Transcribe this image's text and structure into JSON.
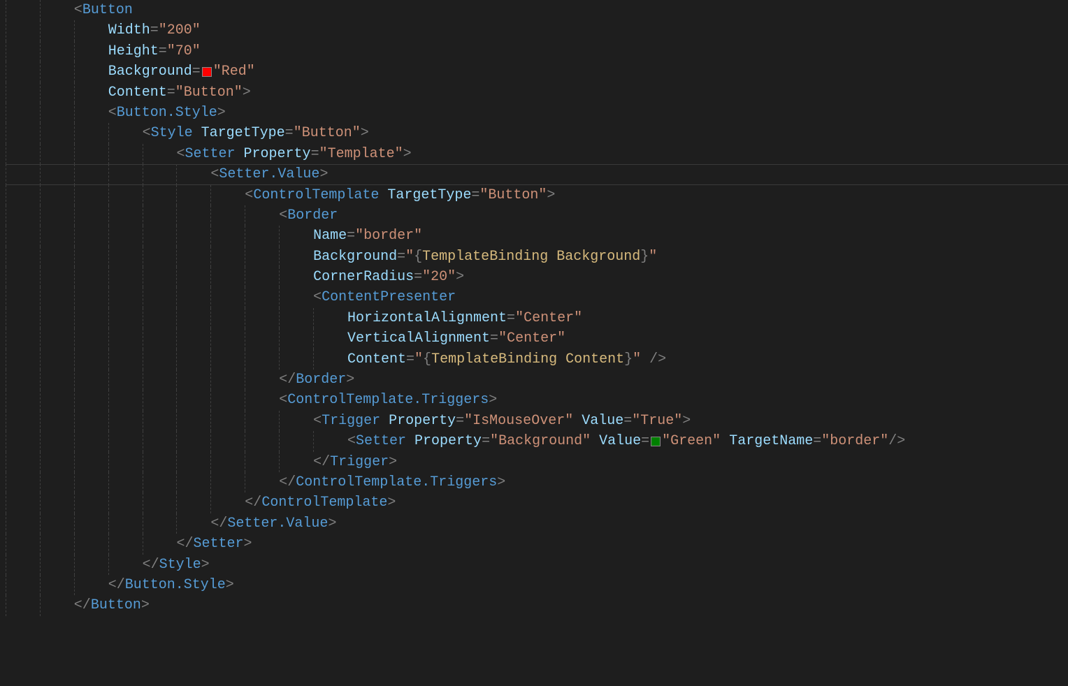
{
  "colors": {
    "red_swatch": "#ff0000",
    "green_swatch": "#008000"
  },
  "lines": [
    {
      "indent": 2,
      "tokens": [
        {
          "t": "p",
          "v": "<"
        },
        {
          "t": "tag",
          "v": "Button"
        }
      ]
    },
    {
      "indent": 3,
      "tokens": [
        {
          "t": "att",
          "v": "Width"
        },
        {
          "t": "p",
          "v": "="
        },
        {
          "t": "str",
          "v": "\"200\""
        }
      ]
    },
    {
      "indent": 3,
      "tokens": [
        {
          "t": "att",
          "v": "Height"
        },
        {
          "t": "p",
          "v": "="
        },
        {
          "t": "str",
          "v": "\"70\""
        }
      ]
    },
    {
      "indent": 3,
      "tokens": [
        {
          "t": "att",
          "v": "Background"
        },
        {
          "t": "p",
          "v": "="
        },
        {
          "t": "sw",
          "v": "red_swatch"
        },
        {
          "t": "str",
          "v": "\"Red\""
        }
      ]
    },
    {
      "indent": 3,
      "tokens": [
        {
          "t": "att",
          "v": "Content"
        },
        {
          "t": "p",
          "v": "="
        },
        {
          "t": "str",
          "v": "\"Button\""
        },
        {
          "t": "p",
          "v": ">"
        }
      ]
    },
    {
      "indent": 3,
      "tokens": [
        {
          "t": "p",
          "v": "<"
        },
        {
          "t": "tag",
          "v": "Button.Style"
        },
        {
          "t": "p",
          "v": ">"
        }
      ]
    },
    {
      "indent": 4,
      "tokens": [
        {
          "t": "p",
          "v": "<"
        },
        {
          "t": "tag",
          "v": "Style"
        },
        {
          "t": "p",
          "v": " "
        },
        {
          "t": "att",
          "v": "TargetType"
        },
        {
          "t": "p",
          "v": "="
        },
        {
          "t": "str",
          "v": "\"Button\""
        },
        {
          "t": "p",
          "v": ">"
        }
      ]
    },
    {
      "indent": 5,
      "tokens": [
        {
          "t": "p",
          "v": "<"
        },
        {
          "t": "tag",
          "v": "Setter"
        },
        {
          "t": "p",
          "v": " "
        },
        {
          "t": "att",
          "v": "Property"
        },
        {
          "t": "p",
          "v": "="
        },
        {
          "t": "str",
          "v": "\"Template\""
        },
        {
          "t": "p",
          "v": ">"
        }
      ]
    },
    {
      "indent": 6,
      "tokens": [
        {
          "t": "p",
          "v": "<"
        },
        {
          "t": "tag",
          "v": "Setter.Value"
        },
        {
          "t": "p",
          "v": ">"
        }
      ],
      "highlight": true
    },
    {
      "indent": 7,
      "tokens": [
        {
          "t": "p",
          "v": "<"
        },
        {
          "t": "tag",
          "v": "ControlTemplate"
        },
        {
          "t": "p",
          "v": " "
        },
        {
          "t": "att",
          "v": "TargetType"
        },
        {
          "t": "p",
          "v": "="
        },
        {
          "t": "str",
          "v": "\"Button\""
        },
        {
          "t": "p",
          "v": ">"
        }
      ]
    },
    {
      "indent": 8,
      "tokens": [
        {
          "t": "p",
          "v": "<"
        },
        {
          "t": "tag",
          "v": "Border"
        }
      ]
    },
    {
      "indent": 9,
      "tokens": [
        {
          "t": "att",
          "v": "Name"
        },
        {
          "t": "p",
          "v": "="
        },
        {
          "t": "str",
          "v": "\"border\""
        }
      ]
    },
    {
      "indent": 9,
      "tokens": [
        {
          "t": "att",
          "v": "Background"
        },
        {
          "t": "p",
          "v": "="
        },
        {
          "t": "str",
          "v": "\""
        },
        {
          "t": "p",
          "v": "{"
        },
        {
          "t": "bind",
          "v": "TemplateBinding"
        },
        {
          "t": "p",
          "v": " "
        },
        {
          "t": "bind",
          "v": "Background"
        },
        {
          "t": "p",
          "v": "}"
        },
        {
          "t": "str",
          "v": "\""
        }
      ]
    },
    {
      "indent": 9,
      "tokens": [
        {
          "t": "att",
          "v": "CornerRadius"
        },
        {
          "t": "p",
          "v": "="
        },
        {
          "t": "str",
          "v": "\"20\""
        },
        {
          "t": "p",
          "v": ">"
        }
      ]
    },
    {
      "indent": 9,
      "tokens": [
        {
          "t": "p",
          "v": "<"
        },
        {
          "t": "tag",
          "v": "ContentPresenter"
        }
      ]
    },
    {
      "indent": 10,
      "tokens": [
        {
          "t": "att",
          "v": "HorizontalAlignment"
        },
        {
          "t": "p",
          "v": "="
        },
        {
          "t": "str",
          "v": "\"Center\""
        }
      ]
    },
    {
      "indent": 10,
      "tokens": [
        {
          "t": "att",
          "v": "VerticalAlignment"
        },
        {
          "t": "p",
          "v": "="
        },
        {
          "t": "str",
          "v": "\"Center\""
        }
      ]
    },
    {
      "indent": 10,
      "tokens": [
        {
          "t": "att",
          "v": "Content"
        },
        {
          "t": "p",
          "v": "="
        },
        {
          "t": "str",
          "v": "\""
        },
        {
          "t": "p",
          "v": "{"
        },
        {
          "t": "bind",
          "v": "TemplateBinding"
        },
        {
          "t": "p",
          "v": " "
        },
        {
          "t": "bind",
          "v": "Content"
        },
        {
          "t": "p",
          "v": "}"
        },
        {
          "t": "str",
          "v": "\""
        },
        {
          "t": "p",
          "v": " />"
        }
      ]
    },
    {
      "indent": 8,
      "tokens": [
        {
          "t": "p",
          "v": "</"
        },
        {
          "t": "tag",
          "v": "Border"
        },
        {
          "t": "p",
          "v": ">"
        }
      ]
    },
    {
      "indent": 8,
      "tokens": [
        {
          "t": "p",
          "v": "<"
        },
        {
          "t": "tag",
          "v": "ControlTemplate.Triggers"
        },
        {
          "t": "p",
          "v": ">"
        }
      ]
    },
    {
      "indent": 9,
      "tokens": [
        {
          "t": "p",
          "v": "<"
        },
        {
          "t": "tag",
          "v": "Trigger"
        },
        {
          "t": "p",
          "v": " "
        },
        {
          "t": "att",
          "v": "Property"
        },
        {
          "t": "p",
          "v": "="
        },
        {
          "t": "str",
          "v": "\"IsMouseOver\""
        },
        {
          "t": "p",
          "v": " "
        },
        {
          "t": "att",
          "v": "Value"
        },
        {
          "t": "p",
          "v": "="
        },
        {
          "t": "str",
          "v": "\"True\""
        },
        {
          "t": "p",
          "v": ">"
        }
      ]
    },
    {
      "indent": 10,
      "tokens": [
        {
          "t": "p",
          "v": "<"
        },
        {
          "t": "tag",
          "v": "Setter"
        },
        {
          "t": "p",
          "v": " "
        },
        {
          "t": "att",
          "v": "Property"
        },
        {
          "t": "p",
          "v": "="
        },
        {
          "t": "str",
          "v": "\"Background\""
        },
        {
          "t": "p",
          "v": " "
        },
        {
          "t": "att",
          "v": "Value"
        },
        {
          "t": "p",
          "v": "="
        },
        {
          "t": "sw",
          "v": "green_swatch"
        },
        {
          "t": "str",
          "v": "\"Green\""
        },
        {
          "t": "p",
          "v": " "
        },
        {
          "t": "att",
          "v": "TargetName"
        },
        {
          "t": "p",
          "v": "="
        },
        {
          "t": "str",
          "v": "\"border\""
        },
        {
          "t": "p",
          "v": "/>"
        }
      ]
    },
    {
      "indent": 9,
      "tokens": [
        {
          "t": "p",
          "v": "</"
        },
        {
          "t": "tag",
          "v": "Trigger"
        },
        {
          "t": "p",
          "v": ">"
        }
      ]
    },
    {
      "indent": 8,
      "tokens": [
        {
          "t": "p",
          "v": "</"
        },
        {
          "t": "tag",
          "v": "ControlTemplate.Triggers"
        },
        {
          "t": "p",
          "v": ">"
        }
      ]
    },
    {
      "indent": 7,
      "tokens": [
        {
          "t": "p",
          "v": "</"
        },
        {
          "t": "tag",
          "v": "ControlTemplate"
        },
        {
          "t": "p",
          "v": ">"
        }
      ]
    },
    {
      "indent": 6,
      "tokens": [
        {
          "t": "p",
          "v": "</"
        },
        {
          "t": "tag",
          "v": "Setter.Value"
        },
        {
          "t": "p",
          "v": ">"
        }
      ]
    },
    {
      "indent": 5,
      "tokens": [
        {
          "t": "p",
          "v": "</"
        },
        {
          "t": "tag",
          "v": "Setter"
        },
        {
          "t": "p",
          "v": ">"
        }
      ]
    },
    {
      "indent": 4,
      "tokens": [
        {
          "t": "p",
          "v": "</"
        },
        {
          "t": "tag",
          "v": "Style"
        },
        {
          "t": "p",
          "v": ">"
        }
      ]
    },
    {
      "indent": 3,
      "tokens": [
        {
          "t": "p",
          "v": "</"
        },
        {
          "t": "tag",
          "v": "Button.Style"
        },
        {
          "t": "p",
          "v": ">"
        }
      ]
    },
    {
      "indent": 2,
      "tokens": [
        {
          "t": "p",
          "v": "</"
        },
        {
          "t": "tag",
          "v": "Button"
        },
        {
          "t": "p",
          "v": ">"
        }
      ]
    }
  ],
  "layout": {
    "guide_width": 48.9,
    "max_guides": 11
  }
}
